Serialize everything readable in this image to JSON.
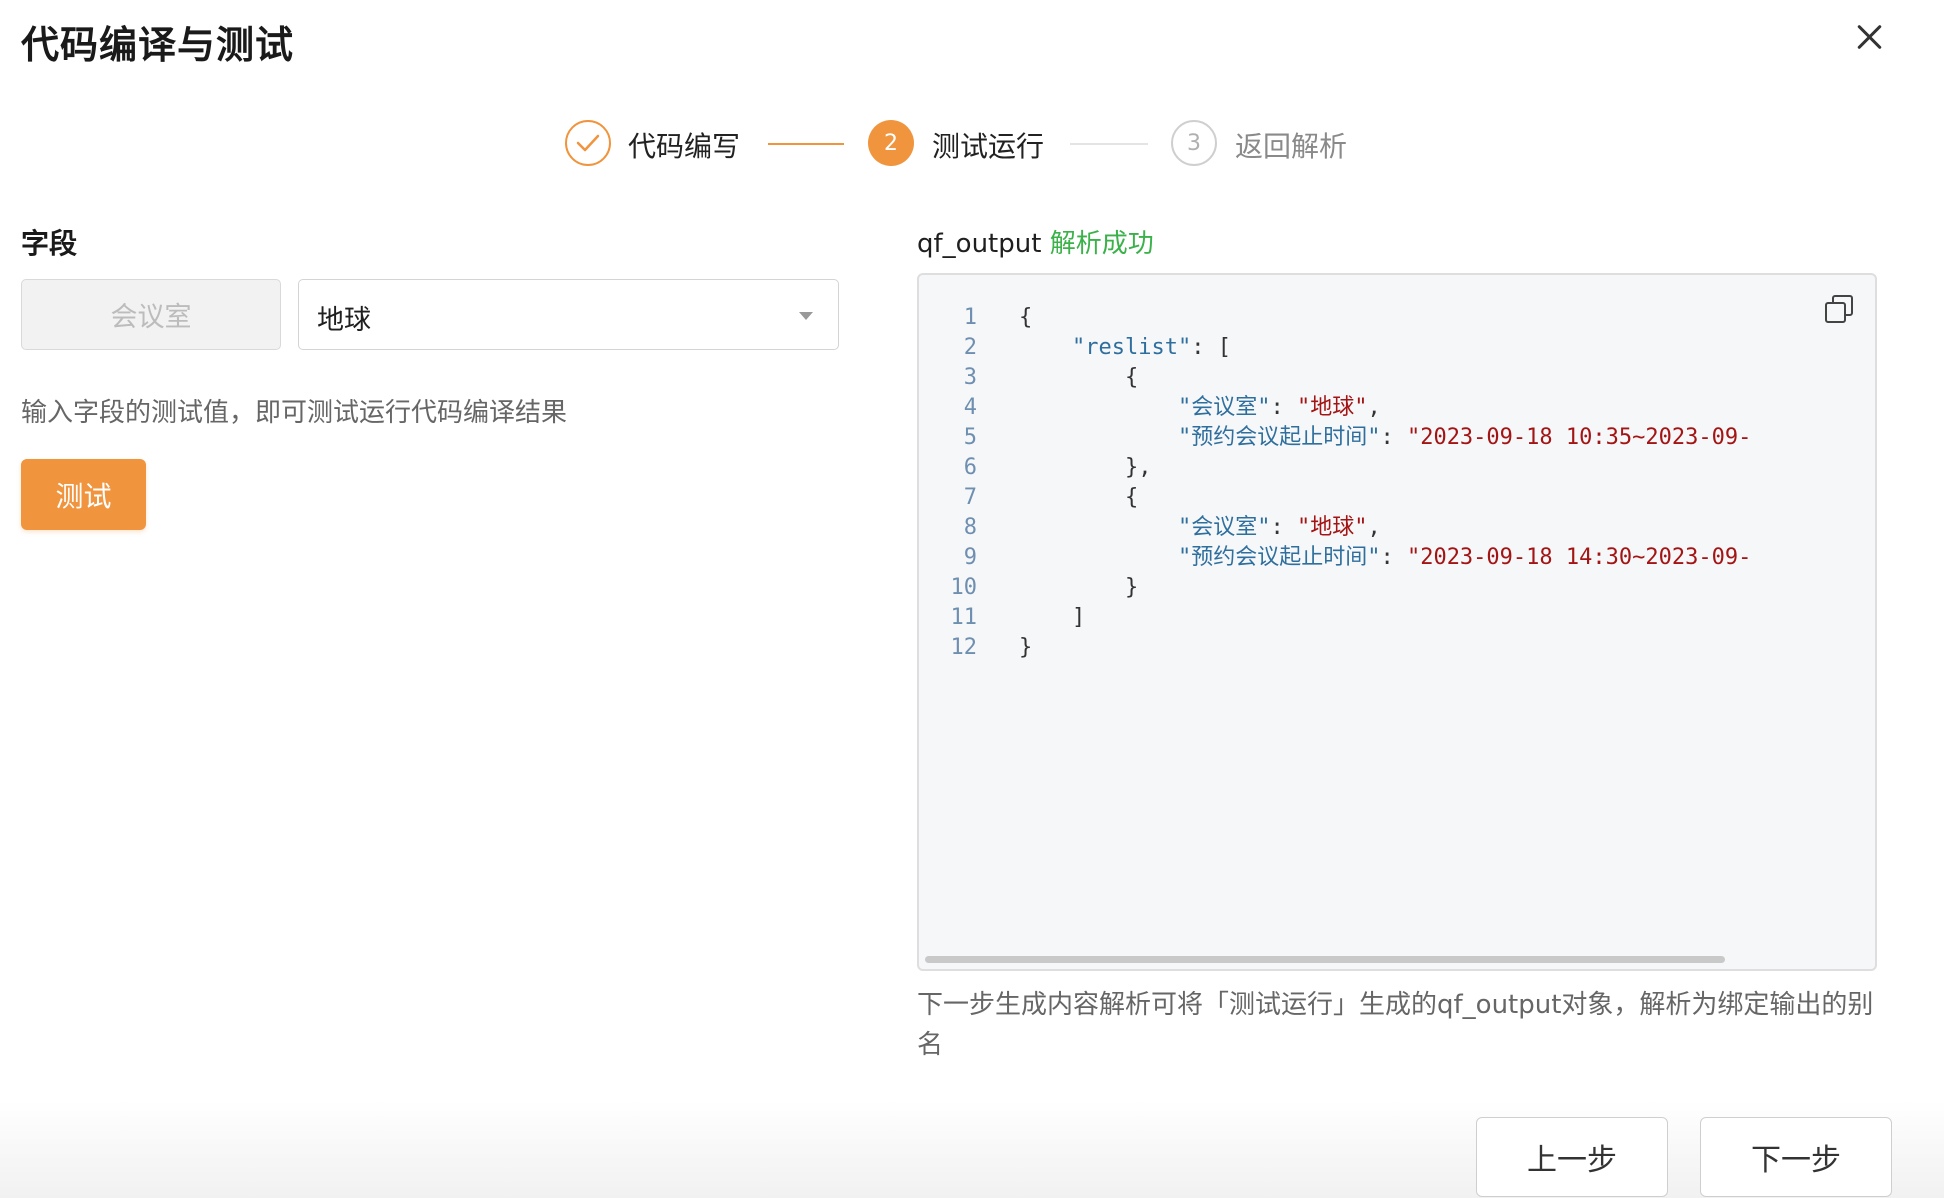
{
  "dialog": {
    "title": "代码编译与测试"
  },
  "steps": [
    {
      "label": "代码编写",
      "status": "done"
    },
    {
      "number": "2",
      "label": "测试运行",
      "status": "active"
    },
    {
      "number": "3",
      "label": "返回解析",
      "status": "wait"
    }
  ],
  "left": {
    "section_title": "字段",
    "field_name": "会议室",
    "select_value": "地球",
    "hint": "输入字段的测试值，即可测试运行代码编译结果",
    "test_button": "测试"
  },
  "output": {
    "name": "qf_output",
    "status": "解析成功",
    "note": "下一步生成内容解析可将「测试运行」生成的qf_output对象，解析为绑定输出的别名",
    "lines": [
      {
        "n": "1",
        "indent": "",
        "parts": [
          [
            "p",
            "{"
          ]
        ]
      },
      {
        "n": "2",
        "indent": "    ",
        "parts": [
          [
            "k",
            "\"reslist\""
          ],
          [
            "p",
            ": ["
          ]
        ]
      },
      {
        "n": "3",
        "indent": "        ",
        "parts": [
          [
            "p",
            "{"
          ]
        ]
      },
      {
        "n": "4",
        "indent": "            ",
        "parts": [
          [
            "k",
            "\"会议室\""
          ],
          [
            "p",
            ": "
          ],
          [
            "s",
            "\"地球\""
          ],
          [
            "p",
            ","
          ]
        ]
      },
      {
        "n": "5",
        "indent": "            ",
        "parts": [
          [
            "k",
            "\"预约会议起止时间\""
          ],
          [
            "p",
            ": "
          ],
          [
            "s",
            "\"2023-09-18 10:35~2023-09-"
          ]
        ]
      },
      {
        "n": "6",
        "indent": "        ",
        "parts": [
          [
            "p",
            "},"
          ]
        ]
      },
      {
        "n": "7",
        "indent": "        ",
        "parts": [
          [
            "p",
            "{"
          ]
        ]
      },
      {
        "n": "8",
        "indent": "            ",
        "parts": [
          [
            "k",
            "\"会议室\""
          ],
          [
            "p",
            ": "
          ],
          [
            "s",
            "\"地球\""
          ],
          [
            "p",
            ","
          ]
        ]
      },
      {
        "n": "9",
        "indent": "            ",
        "parts": [
          [
            "k",
            "\"预约会议起止时间\""
          ],
          [
            "p",
            ": "
          ],
          [
            "s",
            "\"2023-09-18 14:30~2023-09-"
          ]
        ]
      },
      {
        "n": "10",
        "indent": "        ",
        "parts": [
          [
            "p",
            "}"
          ]
        ]
      },
      {
        "n": "11",
        "indent": "    ",
        "parts": [
          [
            "p",
            "]"
          ]
        ]
      },
      {
        "n": "12",
        "indent": "",
        "parts": [
          [
            "p",
            "}"
          ]
        ]
      }
    ]
  },
  "footer": {
    "prev": "上一步",
    "next": "下一步"
  },
  "colors": {
    "accent": "#f0943e",
    "success": "#3bb14a",
    "json_key": "#2f6f9e",
    "json_string": "#a31515"
  },
  "icons": {
    "close": "close-icon",
    "step_done": "check-icon",
    "copy": "copy-icon",
    "select": "chevron-down-icon"
  }
}
